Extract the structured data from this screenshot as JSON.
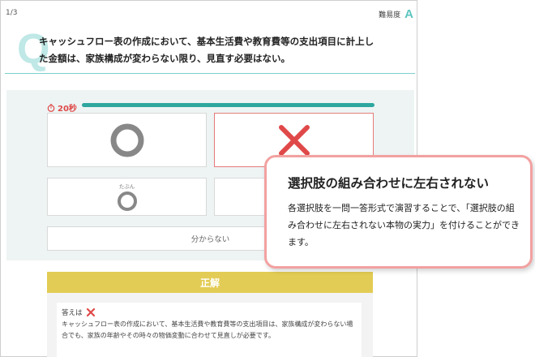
{
  "header": {
    "page_indicator": "1/3",
    "difficulty_label": "難易度",
    "difficulty_grade": "A"
  },
  "question": {
    "mark": "Q",
    "text": "キャッシュフロー表の作成において、基本生活費や教育費等の支出項目に計上した金額は、家族構成が変わらない限り、見直す必要はない。"
  },
  "timer": {
    "label": "20秒",
    "icon": "stopwatch-icon",
    "progress": 1.0
  },
  "choices": {
    "o_icon": "circle-icon",
    "x_icon": "cross-icon",
    "maybe_prefix": "たぶん",
    "dunno_label": "分からない"
  },
  "result": {
    "banner": "正解",
    "answer_label": "答えは",
    "answer_icon": "cross-icon",
    "explanation": "キャッシュフロー表の作成において、基本生活費や教育費等の支出項目は、家族構成が変わらない場合でも、家族の年齢やその時々の物価変動に合わせて見直しが必要です。"
  },
  "callout": {
    "title": "選択肢の組み合わせに左右されない",
    "body": "各選択肢を一問一答形式で演習することで、「選択肢の組み合わせに左右されない本物の実力」を付けることができます。"
  },
  "colors": {
    "accent_teal": "#2ea79f",
    "timer_red": "#e04949",
    "banner_yellow": "#e3cc55",
    "callout_border": "#f3a1a1"
  }
}
